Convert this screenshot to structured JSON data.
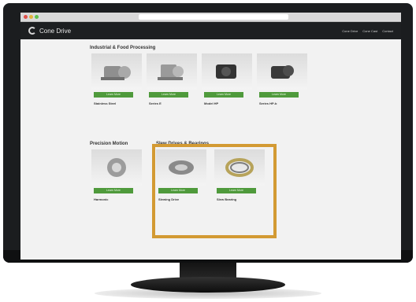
{
  "browser": {
    "url": ""
  },
  "site": {
    "logo_text": "Cone Drive",
    "nav": [
      "Cone Drive",
      "Cone Cast",
      "Contact"
    ]
  },
  "sections": [
    {
      "title": "Industrial & Food Processing",
      "cards": [
        {
          "name": "Stainless Steel",
          "button": "Learn More",
          "desc": ""
        },
        {
          "name": "Series E",
          "button": "Learn More",
          "desc": ""
        },
        {
          "name": "Model HP",
          "button": "Learn More",
          "desc": ""
        },
        {
          "name": "Series HP-b",
          "button": "Learn More",
          "desc": ""
        }
      ]
    },
    {
      "title": "Precision Motion",
      "cards": [
        {
          "name": "Harmonic",
          "button": "Learn More",
          "desc": ""
        }
      ]
    },
    {
      "title": "Slew Drives & Bearings",
      "cards": [
        {
          "name": "Slewing Drive",
          "button": "Learn More",
          "desc": ""
        },
        {
          "name": "Slew Bearing",
          "button": "Learn More",
          "desc": ""
        }
      ]
    }
  ],
  "colors": {
    "highlight": "#d39a33",
    "button": "#4f9a3c",
    "header": "#1d1f21"
  }
}
